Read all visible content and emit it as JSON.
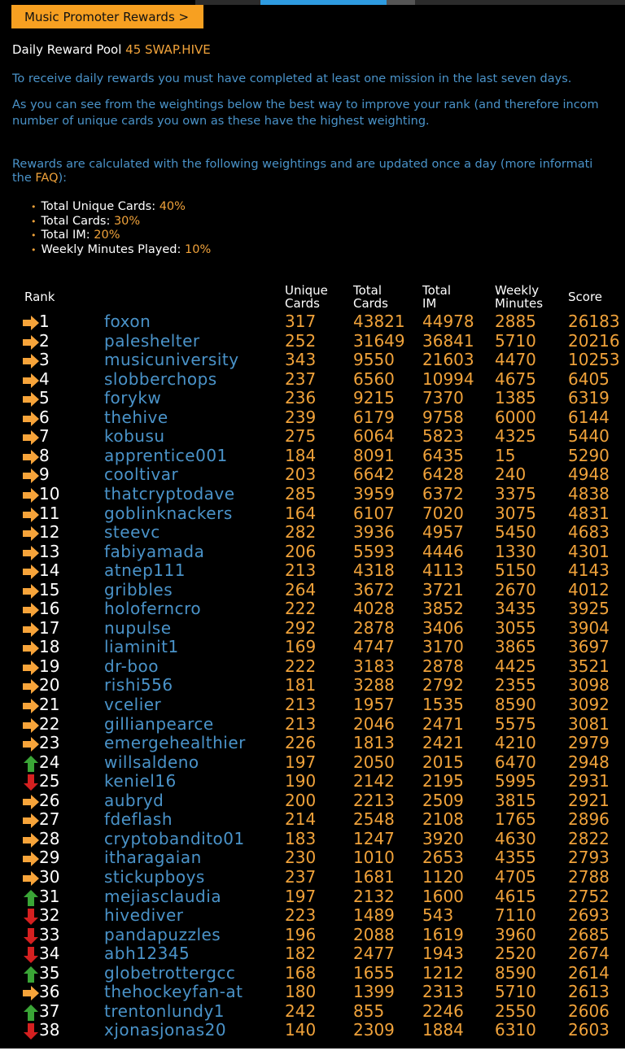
{
  "promo_button": "Music Promoter Rewards >",
  "pool": {
    "label": "Daily Reward Pool",
    "value": "45 SWAP.HIVE"
  },
  "info": {
    "p1": "To receive daily rewards you must have completed at least one mission in the last seven days.",
    "p2a": "As you can see from the weightings below the best way to improve your rank (and therefore incom",
    "p2b": "number of unique cards you own as these have the highest weighting.",
    "p3a": "Rewards are calculated with the following weightings and are updated once a day (more informati",
    "p3b_pre": "the ",
    "p3b_link": "FAQ",
    "p3b_post": "):"
  },
  "weights": [
    {
      "label": "Total Unique Cards:",
      "value": "40%"
    },
    {
      "label": "Total Cards:",
      "value": "30%"
    },
    {
      "label": "Total IM:",
      "value": "20%"
    },
    {
      "label": "Weekly Minutes Played:",
      "value": "10%"
    }
  ],
  "table": {
    "headers": {
      "rank": "Rank",
      "unique_1": "Unique",
      "unique_2": "Cards",
      "total_1": "Total",
      "total_2": "Cards",
      "im_1": "Total",
      "im_2": "IM",
      "weekly_1": "Weekly",
      "weekly_2": "Minutes",
      "score": "Score"
    },
    "colors": {
      "same": "#f7a43a",
      "up": "#3aa536",
      "down": "#d52020"
    },
    "rows": [
      {
        "rank": "1",
        "trend": "same",
        "name": "foxon",
        "unique": "317",
        "total": "43821",
        "im": "44978",
        "weekly": "2885",
        "score": "26183"
      },
      {
        "rank": "2",
        "trend": "same",
        "name": "paleshelter",
        "unique": "252",
        "total": "31649",
        "im": "36841",
        "weekly": "5710",
        "score": "20216"
      },
      {
        "rank": "3",
        "trend": "same",
        "name": "musicuniversity",
        "unique": "343",
        "total": "9550",
        "im": "21603",
        "weekly": "4470",
        "score": "10253"
      },
      {
        "rank": "4",
        "trend": "same",
        "name": "slobberchops",
        "unique": "237",
        "total": "6560",
        "im": "10994",
        "weekly": "4675",
        "score": "6405"
      },
      {
        "rank": "5",
        "trend": "same",
        "name": "forykw",
        "unique": "236",
        "total": "9215",
        "im": "7370",
        "weekly": "1385",
        "score": "6319"
      },
      {
        "rank": "6",
        "trend": "same",
        "name": "thehive",
        "unique": "239",
        "total": "6179",
        "im": "9758",
        "weekly": "6000",
        "score": "6144"
      },
      {
        "rank": "7",
        "trend": "same",
        "name": "kobusu",
        "unique": "275",
        "total": "6064",
        "im": "5823",
        "weekly": "4325",
        "score": "5440"
      },
      {
        "rank": "8",
        "trend": "same",
        "name": "apprentice001",
        "unique": "184",
        "total": "8091",
        "im": "6435",
        "weekly": "15",
        "score": "5290"
      },
      {
        "rank": "9",
        "trend": "same",
        "name": "cooltivar",
        "unique": "203",
        "total": "6642",
        "im": "6428",
        "weekly": "240",
        "score": "4948"
      },
      {
        "rank": "10",
        "trend": "same",
        "name": "thatcryptodave",
        "unique": "285",
        "total": "3959",
        "im": "6372",
        "weekly": "3375",
        "score": "4838"
      },
      {
        "rank": "11",
        "trend": "same",
        "name": "goblinknackers",
        "unique": "164",
        "total": "6107",
        "im": "7020",
        "weekly": "3075",
        "score": "4831"
      },
      {
        "rank": "12",
        "trend": "same",
        "name": "steevc",
        "unique": "282",
        "total": "3936",
        "im": "4957",
        "weekly": "5450",
        "score": "4683"
      },
      {
        "rank": "13",
        "trend": "same",
        "name": "fabiyamada",
        "unique": "206",
        "total": "5593",
        "im": "4446",
        "weekly": "1330",
        "score": "4301"
      },
      {
        "rank": "14",
        "trend": "same",
        "name": "atnep111",
        "unique": "213",
        "total": "4318",
        "im": "4113",
        "weekly": "5150",
        "score": "4143"
      },
      {
        "rank": "15",
        "trend": "same",
        "name": "gribbles",
        "unique": "264",
        "total": "3672",
        "im": "3721",
        "weekly": "2670",
        "score": "4012"
      },
      {
        "rank": "16",
        "trend": "same",
        "name": "holoferncro",
        "unique": "222",
        "total": "4028",
        "im": "3852",
        "weekly": "3435",
        "score": "3925"
      },
      {
        "rank": "17",
        "trend": "same",
        "name": "nupulse",
        "unique": "292",
        "total": "2878",
        "im": "3406",
        "weekly": "3055",
        "score": "3904"
      },
      {
        "rank": "18",
        "trend": "same",
        "name": "liaminit1",
        "unique": "169",
        "total": "4747",
        "im": "3170",
        "weekly": "3865",
        "score": "3697"
      },
      {
        "rank": "19",
        "trend": "same",
        "name": "dr-boo",
        "unique": "222",
        "total": "3183",
        "im": "2878",
        "weekly": "4425",
        "score": "3521"
      },
      {
        "rank": "20",
        "trend": "same",
        "name": "rishi556",
        "unique": "181",
        "total": "3288",
        "im": "2792",
        "weekly": "2355",
        "score": "3098"
      },
      {
        "rank": "21",
        "trend": "same",
        "name": "vcelier",
        "unique": "213",
        "total": "1957",
        "im": "1535",
        "weekly": "8590",
        "score": "3092"
      },
      {
        "rank": "22",
        "trend": "same",
        "name": "gillianpearce",
        "unique": "213",
        "total": "2046",
        "im": "2471",
        "weekly": "5575",
        "score": "3081"
      },
      {
        "rank": "23",
        "trend": "same",
        "name": "emergehealthier",
        "unique": "226",
        "total": "1813",
        "im": "2421",
        "weekly": "4210",
        "score": "2979"
      },
      {
        "rank": "24",
        "trend": "up",
        "name": "willsaldeno",
        "unique": "197",
        "total": "2050",
        "im": "2015",
        "weekly": "6470",
        "score": "2948"
      },
      {
        "rank": "25",
        "trend": "down",
        "name": "keniel16",
        "unique": "190",
        "total": "2142",
        "im": "2195",
        "weekly": "5995",
        "score": "2931"
      },
      {
        "rank": "26",
        "trend": "same",
        "name": "aubryd",
        "unique": "200",
        "total": "2213",
        "im": "2509",
        "weekly": "3815",
        "score": "2921"
      },
      {
        "rank": "27",
        "trend": "same",
        "name": "fdeflash",
        "unique": "214",
        "total": "2548",
        "im": "2108",
        "weekly": "1765",
        "score": "2896"
      },
      {
        "rank": "28",
        "trend": "same",
        "name": "cryptobandito01",
        "unique": "183",
        "total": "1247",
        "im": "3920",
        "weekly": "4630",
        "score": "2822"
      },
      {
        "rank": "29",
        "trend": "same",
        "name": "itharagaian",
        "unique": "230",
        "total": "1010",
        "im": "2653",
        "weekly": "4355",
        "score": "2793"
      },
      {
        "rank": "30",
        "trend": "same",
        "name": "stickupboys",
        "unique": "237",
        "total": "1681",
        "im": "1120",
        "weekly": "4705",
        "score": "2788"
      },
      {
        "rank": "31",
        "trend": "up",
        "name": "mejiasclaudia",
        "unique": "197",
        "total": "2132",
        "im": "1600",
        "weekly": "4615",
        "score": "2752"
      },
      {
        "rank": "32",
        "trend": "down",
        "name": "hivediver",
        "unique": "223",
        "total": "1489",
        "im": "543",
        "weekly": "7110",
        "score": "2693"
      },
      {
        "rank": "33",
        "trend": "down",
        "name": "pandapuzzles",
        "unique": "196",
        "total": "2088",
        "im": "1619",
        "weekly": "3960",
        "score": "2685"
      },
      {
        "rank": "34",
        "trend": "down",
        "name": "abh12345",
        "unique": "182",
        "total": "2477",
        "im": "1943",
        "weekly": "2520",
        "score": "2674"
      },
      {
        "rank": "35",
        "trend": "up",
        "name": "globetrottergcc",
        "unique": "168",
        "total": "1655",
        "im": "1212",
        "weekly": "8590",
        "score": "2614"
      },
      {
        "rank": "36",
        "trend": "same",
        "name": "thehockeyfan-at",
        "unique": "180",
        "total": "1399",
        "im": "2313",
        "weekly": "5710",
        "score": "2613"
      },
      {
        "rank": "37",
        "trend": "up",
        "name": "trentonlundy1",
        "unique": "242",
        "total": "855",
        "im": "2246",
        "weekly": "2550",
        "score": "2606"
      },
      {
        "rank": "38",
        "trend": "down",
        "name": "xjonasjonas20",
        "unique": "140",
        "total": "2309",
        "im": "1884",
        "weekly": "6310",
        "score": "2603"
      }
    ]
  }
}
